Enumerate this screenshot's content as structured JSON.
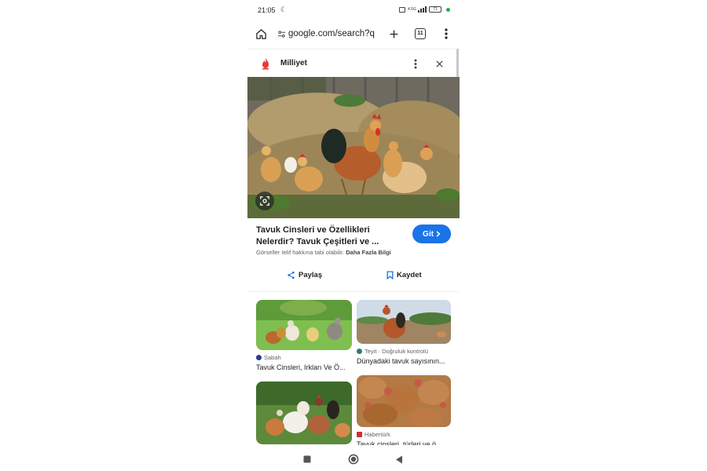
{
  "status_bar": {
    "time": "21:05",
    "network": "4.5G",
    "battery": "71"
  },
  "browser": {
    "url": "google.com/search?q",
    "tab_count": "11"
  },
  "panel": {
    "site_name": "Milliyet",
    "title": "Tavuk Cinsleri ve Özellikleri Nelerdir? Tavuk Çeşitleri ve ...",
    "go_button": "Git",
    "copyright_text": "Görseller telif hakkına tabi olabilir.",
    "more_info": "Daha Fazla Bilgi",
    "share_label": "Paylaş",
    "save_label": "Kaydet"
  },
  "related": [
    {
      "source": "Sabah",
      "caption": "Tavuk Cinsleri, Irkları Ve Ö...",
      "source_color": "#2b3a8c"
    },
    {
      "source": "Teyit · Doğruluk kontrolü",
      "caption": "Dünyadaki tavuk sayısının...",
      "source_color": "#2e7d6b"
    },
    {
      "source": "",
      "caption": "",
      "source_color": "#ffffff"
    },
    {
      "source": "Habertürk",
      "caption": "Tavuk cinsleri, türleri ve ö...",
      "source_color": "#d32f2f"
    }
  ],
  "icons": {
    "home": "home-icon",
    "tune": "site-info-icon",
    "new_tab": "plus-icon",
    "menu": "kebab-menu-icon",
    "close": "close-icon",
    "lens": "google-lens-icon",
    "share": "share-icon",
    "bookmark": "bookmark-icon",
    "recents": "square-icon",
    "home_nav": "circle-icon",
    "back": "triangle-back-icon"
  },
  "colors": {
    "accent": "#1a73e8",
    "site_logo": "#e53935"
  }
}
